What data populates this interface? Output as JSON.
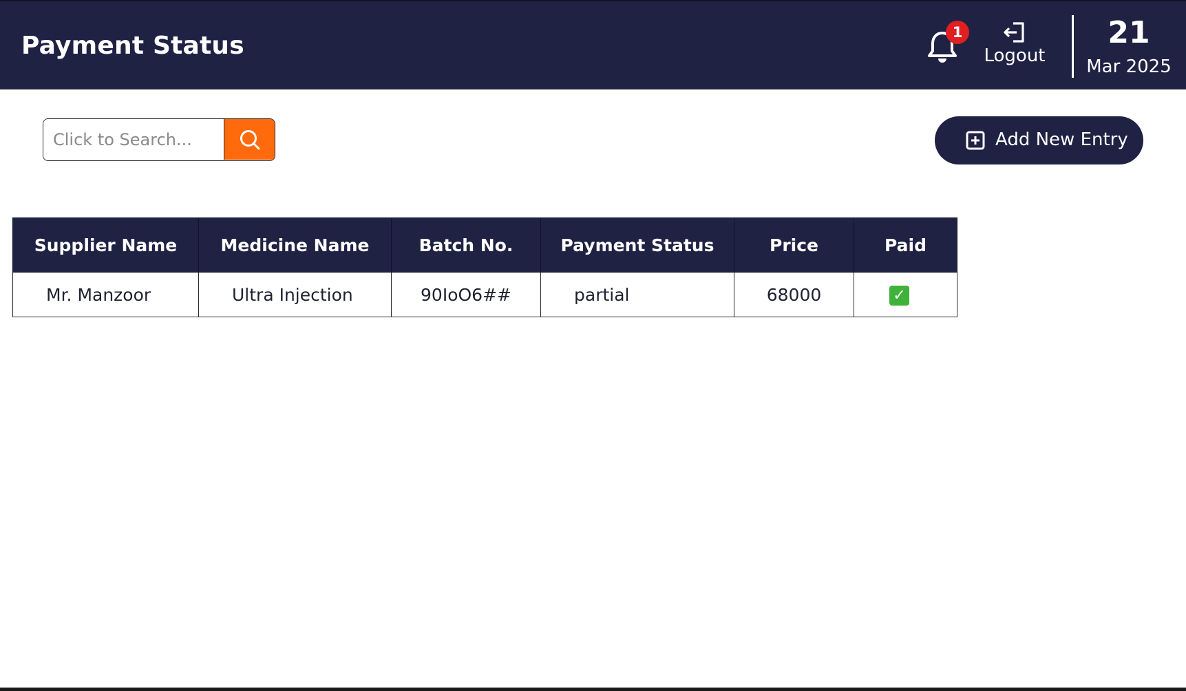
{
  "header": {
    "title": "Payment Status",
    "notifications": {
      "count": "1"
    },
    "logout_label": "Logout",
    "date": {
      "day": "21",
      "month_year": "Mar 2025"
    }
  },
  "toolbar": {
    "search_placeholder": "Click to Search...",
    "add_label": "Add New Entry"
  },
  "table": {
    "columns": [
      "Supplier Name",
      "Medicine Name",
      "Batch No.",
      "Payment Status",
      "Price",
      "Paid"
    ],
    "rows": [
      {
        "supplier_name": "Mr. Manzoor",
        "medicine_name": "Ultra Injection",
        "batch_no": "90IoO6##",
        "payment_status": "partial",
        "price": "68000",
        "paid": "✓"
      }
    ]
  },
  "colors": {
    "header_bg": "#1f2243",
    "accent_orange": "#ff6a0d",
    "badge_red": "#e02020",
    "check_green": "#3fb23a"
  },
  "icons": {
    "notification": "bell-icon",
    "logout": "logout-icon",
    "search": "search-icon",
    "add": "plus-square-icon",
    "paid": "check-mark-icon"
  }
}
